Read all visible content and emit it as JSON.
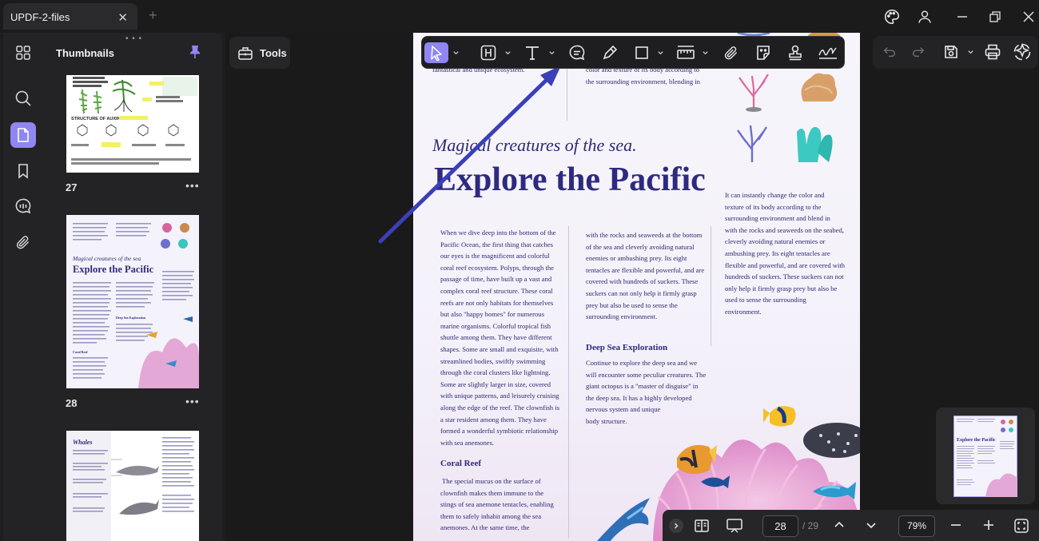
{
  "app": {
    "tab_title": "UPDF-2-files",
    "tab_close": "✕",
    "tab_add": "+"
  },
  "sidebar": {
    "header": "Thumbnails",
    "handle": "• • •",
    "thumbnails": [
      {
        "page": "27"
      },
      {
        "page": "28",
        "selected": true
      },
      {
        "page": ""
      }
    ],
    "more": "•••"
  },
  "tools": {
    "label": "Tools"
  },
  "document": {
    "subtitle": "Magical creatures of the sea.",
    "title": "Explore the Pacific",
    "top_col1": "labyrinth\", giving birth to countless\nastonishing creatures and constituting a\nfantastical and unique ecosystem.",
    "top_col2": "developed nervous system and unique body\nstructure, and can instantly change the\ncolor and texture of its body according to\nthe surrounding environment, blending in",
    "col1_main": "When we dive deep into the bottom of the\nPacific Ocean, the first thing that catches\nour eyes is the magnificent and colorful\ncoral reef ecosystem. Polyps, through the\npassage of time, have built up a vast and\ncomplex coral reef structure. These coral\nreefs are not only habitats for themselves\nbut also \"happy homes\" for numerous\nmarine organisms. Colorful tropical fish\nshuttle among them. They have different\nshapes. Some are small and exquisite, with\nstreamlined bodies, swiftly swimming\nthrough the coral clusters like lightning.\nSome are slightly larger in size, covered\nwith unique patterns, and leisurely cruising\nalong the edge of the reef. The clownfish is\na star resident among them. They have\nformed a wonderful symbiotic relationship\nwith sea anemones.",
    "coral_reef_heading": "Coral Reef",
    "coral_reef_text": " The special mucus on the surface of\nclownfish makes them immune to the\nstings of sea anemone tentacles, enabling\nthem to safely inhabit among the sea\nanemones. At the same time, the",
    "col2_main": "with the rocks and seaweeds at the bottom\nof the sea and cleverly avoiding natural\nenemies or ambushing prey. Its eight\ntentacles are flexible and powerful, and are\ncovered with hundreds of suckers. These\nsuckers can not only help it firmly grasp\nprey but also be used to sense the\nsurrounding environment.",
    "deep_sea_heading": "Deep Sea Exploration",
    "deep_sea_text": "Continue to explore the deep sea and we\nwill encounter some peculiar creatures. The\ngiant octopus is a \"master of disguise\" in\nthe deep sea. It has a highly developed\nnervous system and unique\nbody structure.",
    "col3_main": "It can instantly change the color and\ntexture of its body according to the\nsurrounding environment and blend in\nwith the rocks and seaweeds on the seabed,\ncleverly avoiding natural enemies or\nambushing prey. Its eight tentacles are\nflexible and powerful, and are covered with\nhundreds of suckers. These suckers can not\nonly help it firmly grasp prey but also be\nused to sense the surrounding\nenvironment."
  },
  "thumb28": {
    "subtitle": "Magical creatures of the sea",
    "title": "Explore the Pacific",
    "coral": "Coral Reef",
    "deep": "Deep Sea Exploration"
  },
  "thumb27": {
    "heading": "STRUCTURE OF AUXIN"
  },
  "thumb29": {
    "title": "Whales"
  },
  "mini": {
    "title": "Explore the Pacific"
  },
  "bottom": {
    "page": "28",
    "total": "/ 29",
    "zoom": "79%"
  },
  "colors": {
    "accent": "#8f86f3",
    "arrow": "#3b3fb8",
    "doc_text": "#2c2a6e"
  }
}
